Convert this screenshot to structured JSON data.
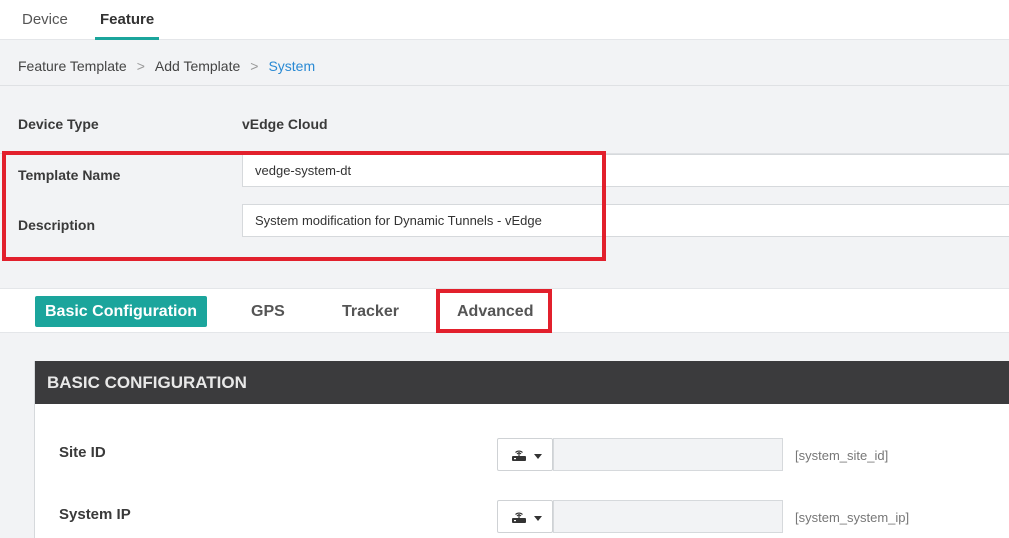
{
  "top_tabs": {
    "device": "Device",
    "feature": "Feature"
  },
  "breadcrumb": {
    "items": [
      "Feature Template",
      "Add Template",
      "System"
    ],
    "separator": ">"
  },
  "form": {
    "device_type_label": "Device Type",
    "device_type_value": "vEdge Cloud",
    "template_name_label": "Template Name",
    "template_name_value": "vedge-system-dt",
    "description_label": "Description",
    "description_value": "System modification for Dynamic Tunnels - vEdge"
  },
  "sub_tabs": [
    "Basic Configuration",
    "GPS",
    "Tracker",
    "Advanced"
  ],
  "section": {
    "title": "BASIC CONFIGURATION",
    "fields": [
      {
        "label": "Site ID",
        "variable": "[system_site_id]",
        "icon": "device-specific-icon"
      },
      {
        "label": "System IP",
        "variable": "[system_system_ip]",
        "icon": "device-specific-icon"
      }
    ]
  },
  "colors": {
    "accent": "#1ba59c",
    "link": "#2a8ad4",
    "highlight": "#e2202c",
    "section_header": "#3b3b3d"
  }
}
